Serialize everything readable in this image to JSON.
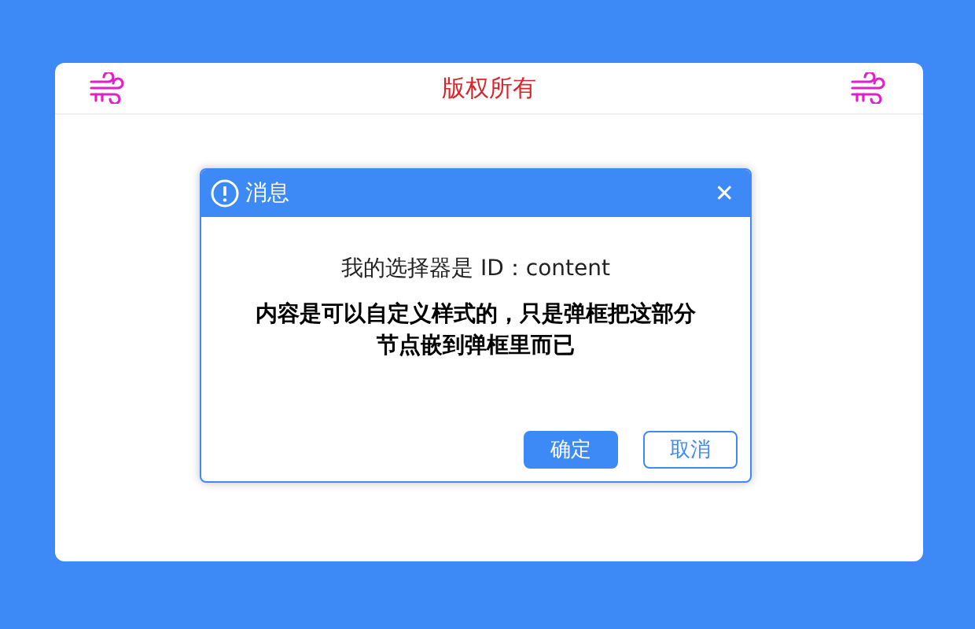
{
  "page_header": {
    "title": "版权所有"
  },
  "dialog": {
    "title": "消息",
    "close": "✕",
    "line": "我的选择器是 ID：content",
    "message": "内容是可以自定义样式的，只是弹框把这部分节点嵌到弹框里而已",
    "buttons": [
      {
        "label": "确定",
        "kind": "primary"
      },
      {
        "label": "取消",
        "kind": "secondary"
      }
    ]
  }
}
